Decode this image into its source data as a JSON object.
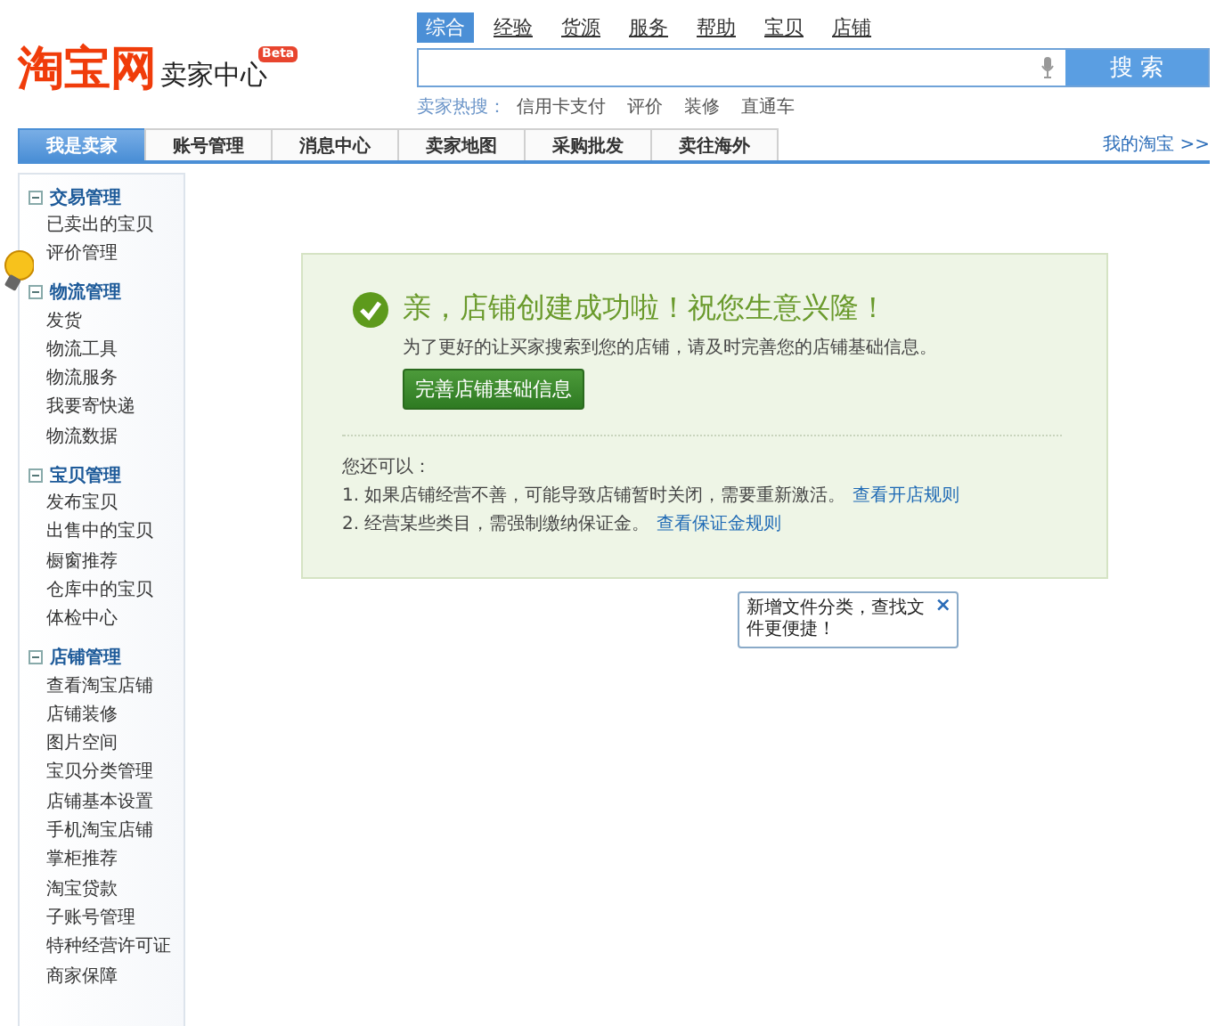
{
  "logo": {
    "brand": "淘宝网",
    "subtitle": "卖家中心",
    "badge": "Beta"
  },
  "search": {
    "tabs": [
      {
        "label": "综合",
        "selected": true
      },
      {
        "label": "经验",
        "selected": false
      },
      {
        "label": "货源",
        "selected": false
      },
      {
        "label": "服务",
        "selected": false
      },
      {
        "label": "帮助",
        "selected": false
      },
      {
        "label": "宝贝",
        "selected": false
      },
      {
        "label": "店铺",
        "selected": false
      }
    ],
    "button": "搜 索",
    "hot_label": "卖家热搜：",
    "hot_items": [
      "信用卡支付",
      "评价",
      "装修",
      "直通车"
    ]
  },
  "nav": {
    "tabs": [
      {
        "label": "我是卖家",
        "selected": true
      },
      {
        "label": "账号管理",
        "selected": false
      },
      {
        "label": "消息中心",
        "selected": false
      },
      {
        "label": "卖家地图",
        "selected": false
      },
      {
        "label": "采购批发",
        "selected": false
      },
      {
        "label": "卖往海外",
        "selected": false
      }
    ],
    "link": "我的淘宝 >>"
  },
  "sidebar": {
    "groups": [
      {
        "title": "交易管理",
        "expanded": true,
        "items": [
          "已卖出的宝贝",
          "评价管理"
        ]
      },
      {
        "title": "物流管理",
        "expanded": true,
        "items": [
          "发货",
          "物流工具",
          "物流服务",
          "我要寄快递",
          "物流数据"
        ]
      },
      {
        "title": "宝贝管理",
        "expanded": true,
        "items": [
          "发布宝贝",
          "出售中的宝贝",
          "橱窗推荐",
          "仓库中的宝贝",
          "体检中心"
        ]
      },
      {
        "title": "店铺管理",
        "expanded": true,
        "items": [
          "查看淘宝店铺",
          "店铺装修",
          "图片空间",
          "宝贝分类管理",
          "店铺基本设置",
          "手机淘宝店铺",
          "掌柜推荐",
          "淘宝贷款",
          "子账号管理",
          "特种经营许可证",
          "商家保障"
        ]
      }
    ]
  },
  "notice": {
    "title": "亲，店铺创建成功啦！祝您生意兴隆！",
    "subtitle": "为了更好的让买家搜索到您的店铺，请及时完善您的店铺基础信息。",
    "button": "完善店铺基础信息",
    "options_heading": "您还可以：",
    "options": [
      {
        "text": "1. 如果店铺经营不善，可能导致店铺暂时关闭，需要重新激活。",
        "link": "查看开店规则"
      },
      {
        "text": "2. 经营某些类目，需强制缴纳保证金。",
        "link": "查看保证金规则"
      }
    ]
  },
  "tooltip": {
    "text": "新增文件分类，查找文件更便捷！",
    "close": "×"
  }
}
